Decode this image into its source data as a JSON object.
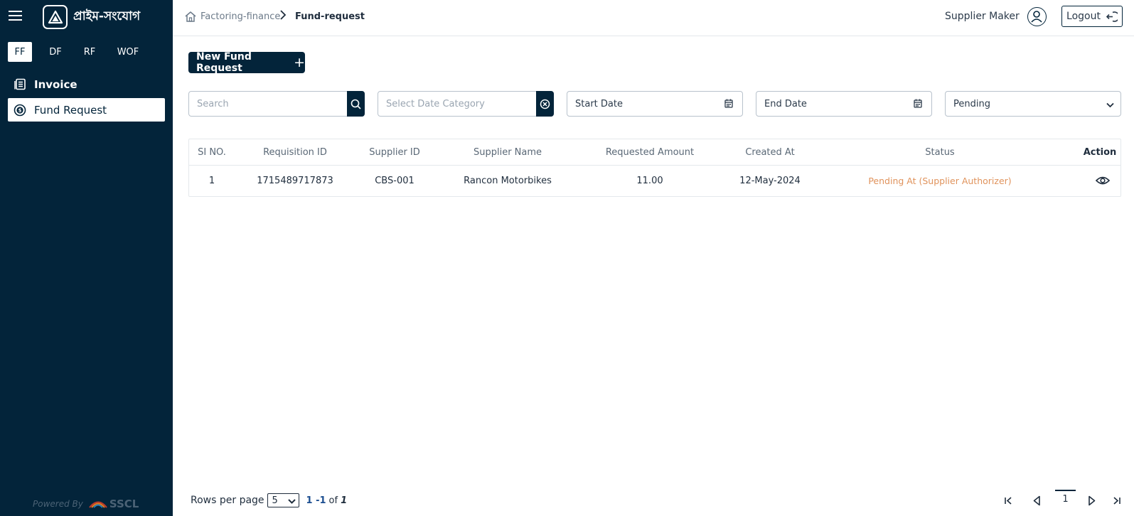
{
  "brand": {
    "name": "প্রাইম-সংযোগ"
  },
  "sidebar": {
    "product_tabs": [
      {
        "label": "FF",
        "active": true
      },
      {
        "label": "DF",
        "active": false
      },
      {
        "label": "RF",
        "active": false
      },
      {
        "label": "WOF",
        "active": false
      }
    ],
    "items": [
      {
        "label": "Invoice",
        "icon": "document-list-icon",
        "active": false
      },
      {
        "label": "Fund Request",
        "icon": "dollar-circle-icon",
        "active": true
      }
    ],
    "powered_by": "Powered By",
    "powered_by_logo": "SSCL"
  },
  "header": {
    "breadcrumb_home": "Factoring-finance",
    "breadcrumb_current": "Fund-request",
    "user_name": "Supplier Maker",
    "logout_label": "Logout"
  },
  "toolbar": {
    "new_button": "New Fund Request",
    "search_placeholder": "Search",
    "date_category_placeholder": "Select Date Category",
    "start_date_placeholder": "Start Date",
    "end_date_placeholder": "End Date",
    "status_filter_value": "Pending"
  },
  "table": {
    "columns": [
      "SI NO.",
      "Requisition ID",
      "Supplier ID",
      "Supplier Name",
      "Requested Amount",
      "Created At",
      "Status",
      "Action"
    ],
    "rows": [
      {
        "si_no": "1",
        "requisition_id": "1715489717873",
        "supplier_id": "CBS-001",
        "supplier_name": "Rancon Motorbikes",
        "requested_amount": "11.00",
        "created_at": "12-May-2024",
        "status": "Pending At (Supplier Authorizer)"
      }
    ]
  },
  "pagination": {
    "rows_per_page_label": "Rows per page",
    "rows_per_page_value": "5",
    "range": "1 -1",
    "of_label": "of",
    "total": "1",
    "current_page": "1"
  },
  "colors": {
    "sidebar_bg": "#03243a",
    "accent": "#03243a",
    "status_pending": "#e0935c",
    "link_blue": "#1d4f91"
  }
}
